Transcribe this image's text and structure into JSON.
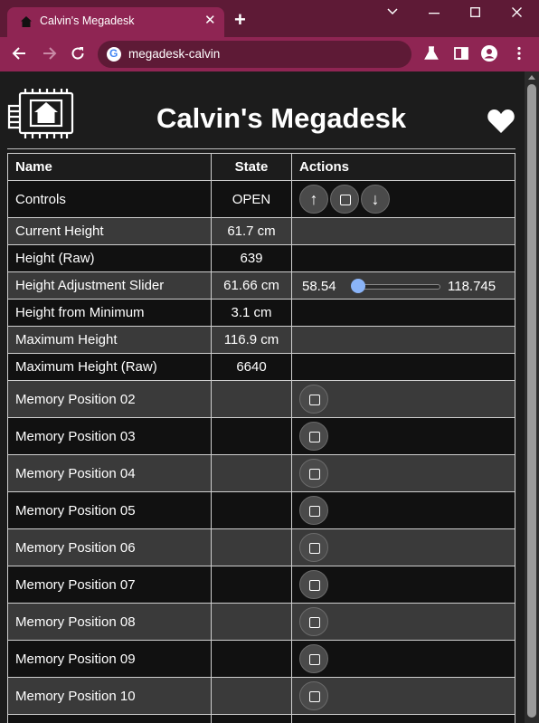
{
  "browser": {
    "tab_title": "Calvin's Megadesk",
    "url": "megadesk-calvin"
  },
  "page": {
    "title": "Calvin's Megadesk"
  },
  "table": {
    "headers": {
      "name": "Name",
      "state": "State",
      "actions": "Actions"
    },
    "rows": [
      {
        "name": "Controls",
        "state": "OPEN",
        "action": "controls"
      },
      {
        "name": "Current Height",
        "state": "61.7 cm",
        "action": "none"
      },
      {
        "name": "Height (Raw)",
        "state": "639",
        "action": "none"
      },
      {
        "name": "Height Adjustment Slider",
        "state": "61.66 cm",
        "action": "slider"
      },
      {
        "name": "Height from Minimum",
        "state": "3.1 cm",
        "action": "none"
      },
      {
        "name": "Maximum Height",
        "state": "116.9 cm",
        "action": "none"
      },
      {
        "name": "Maximum Height (Raw)",
        "state": "6640",
        "action": "none"
      },
      {
        "name": "Memory Position 02",
        "state": "",
        "action": "button"
      },
      {
        "name": "Memory Position 03",
        "state": "",
        "action": "button"
      },
      {
        "name": "Memory Position 04",
        "state": "",
        "action": "button"
      },
      {
        "name": "Memory Position 05",
        "state": "",
        "action": "button"
      },
      {
        "name": "Memory Position 06",
        "state": "",
        "action": "button"
      },
      {
        "name": "Memory Position 07",
        "state": "",
        "action": "button"
      },
      {
        "name": "Memory Position 08",
        "state": "",
        "action": "button"
      },
      {
        "name": "Memory Position 09",
        "state": "",
        "action": "button"
      },
      {
        "name": "Memory Position 10",
        "state": "",
        "action": "button"
      },
      {
        "name": "",
        "state": "",
        "action": "none"
      }
    ]
  },
  "slider": {
    "min": "58.54",
    "max": "118.745",
    "value": 61.66
  },
  "icons": {
    "up": "arrow-up-icon",
    "stop": "stop-icon",
    "down": "arrow-down-icon",
    "favorite": "heart-icon",
    "logo": "house-logo-icon"
  },
  "colors": {
    "titlebar": "#5e1a36",
    "toolbar": "#8f2553",
    "page_bg": "#1c1c1c",
    "row_odd": "#3a3a3a",
    "row_even": "#111111",
    "slider_accent": "#8ab4f8"
  }
}
